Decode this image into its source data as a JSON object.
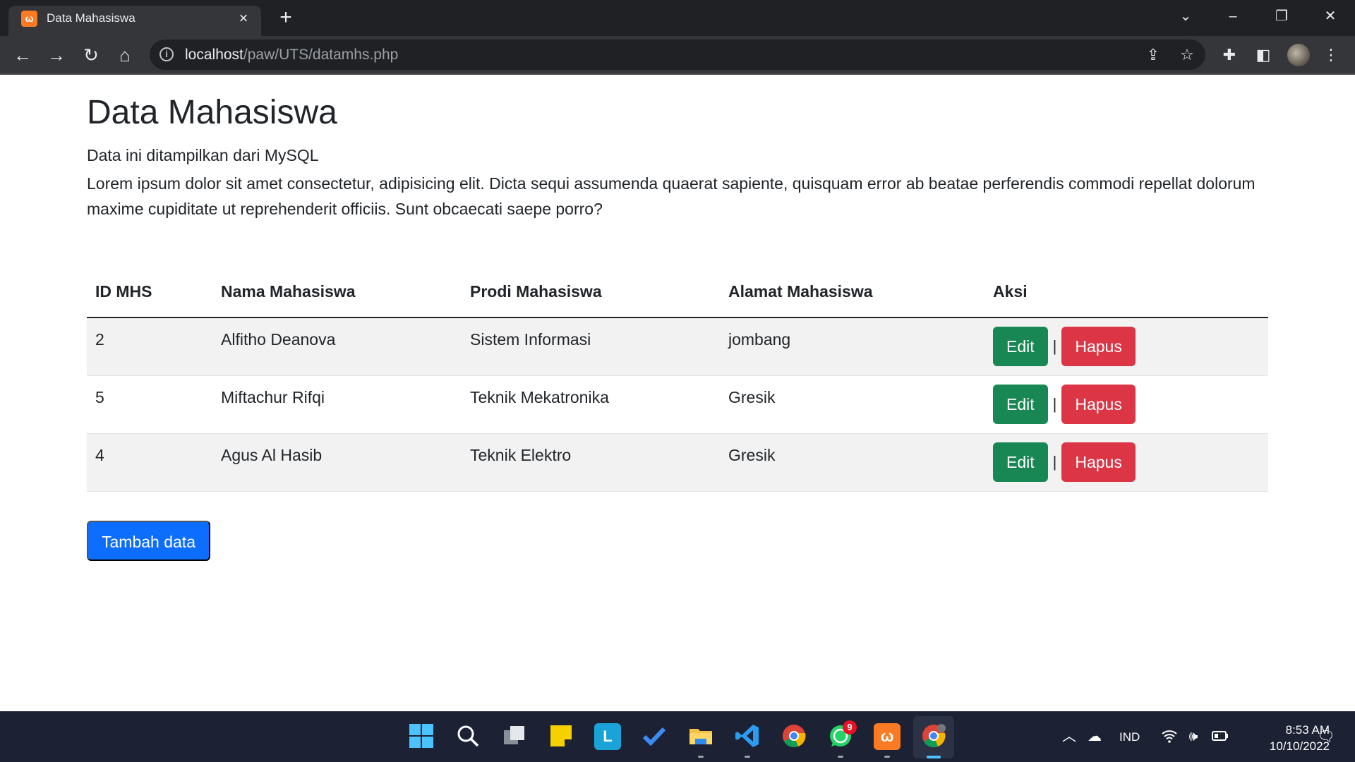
{
  "browser": {
    "tab_title": "Data Mahasiswa",
    "url_host": "localhost",
    "url_path": "/paw/UTS/datamhs.php"
  },
  "page": {
    "title": "Data Mahasiswa",
    "subtitle": "Data ini ditampilkan dari MySQL",
    "description": "Lorem ipsum dolor sit amet consectetur, adipisicing elit. Dicta sequi assumenda quaerat sapiente, quisquam error ab beatae perferendis commodi repellat dolorum maxime cupiditate ut reprehenderit officiis. Sunt obcaecati saepe porro?"
  },
  "table": {
    "headers": [
      "ID MHS",
      "Nama Mahasiswa",
      "Prodi Mahasiswa",
      "Alamat Mahasiswa",
      "Aksi"
    ],
    "rows": [
      {
        "id": "2",
        "nama": "Alfitho Deanova",
        "prodi": "Sistem Informasi",
        "alamat": "jombang"
      },
      {
        "id": "5",
        "nama": "Miftachur Rifqi",
        "prodi": "Teknik Mekatronika",
        "alamat": "Gresik"
      },
      {
        "id": "4",
        "nama": "Agus Al Hasib",
        "prodi": "Teknik Elektro",
        "alamat": "Gresik"
      }
    ],
    "edit_label": "Edit",
    "delete_label": "Hapus",
    "separator": "|"
  },
  "actions": {
    "add_label": "Tambah data"
  },
  "taskbar": {
    "whatsapp_badge": "9",
    "language": "IND",
    "time": "8:53 AM",
    "date": "10/10/2022"
  },
  "colors": {
    "edit": "#198754",
    "delete": "#dc3545",
    "primary": "#0d6efd",
    "xampp": "#fb7a24"
  }
}
